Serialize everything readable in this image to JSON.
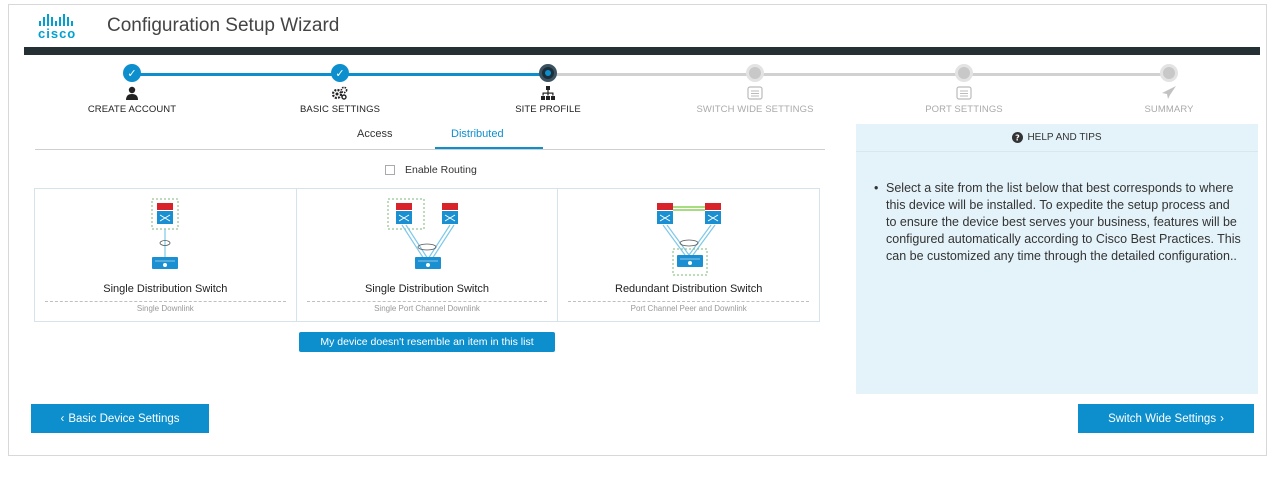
{
  "header": {
    "logo_text": "cisco",
    "title": "Configuration Setup Wizard"
  },
  "steps": [
    {
      "label": "CREATE ACCOUNT",
      "state": "done",
      "icon": "user-icon"
    },
    {
      "label": "BASIC SETTINGS",
      "state": "done",
      "icon": "gears-icon"
    },
    {
      "label": "SITE PROFILE",
      "state": "current",
      "icon": "sitemap-icon"
    },
    {
      "label": "SWITCH WIDE SETTINGS",
      "state": "todo",
      "icon": "switch-icon"
    },
    {
      "label": "PORT SETTINGS",
      "state": "todo",
      "icon": "port-icon"
    },
    {
      "label": "SUMMARY",
      "state": "todo",
      "icon": "send-icon"
    }
  ],
  "tabs": {
    "access": "Access",
    "distributed": "Distributed",
    "active": "distributed"
  },
  "enable_routing": {
    "label": "Enable Routing",
    "checked": false
  },
  "cards": [
    {
      "title": "Single Distribution Switch",
      "subtitle": "Single Downlink"
    },
    {
      "title": "Single Distribution Switch",
      "subtitle": "Single Port Channel Downlink"
    },
    {
      "title": "Redundant Distribution Switch",
      "subtitle": "Port Channel Peer and Downlink"
    }
  ],
  "resemble_button": "My device doesn't resemble an item in this list",
  "help": {
    "title": "HELP AND TIPS",
    "icon": "question-circle-icon",
    "text": "Select a site from the list below that best corresponds to where this device will be installed. To expedite the setup process and to ensure the device best serves your business, features will be configured automatically according to Cisco Best Practices. This can be customized any time through the detailed configuration.."
  },
  "nav": {
    "prev_label": "Basic Device Settings",
    "next_label": "Switch Wide Settings"
  },
  "colors": {
    "accent": "#0d8fcd",
    "dark_bar": "#253034",
    "help_bg": "#e4f3fa",
    "switch_red": "#d8232a",
    "switch_blue": "#1a8fd1"
  }
}
